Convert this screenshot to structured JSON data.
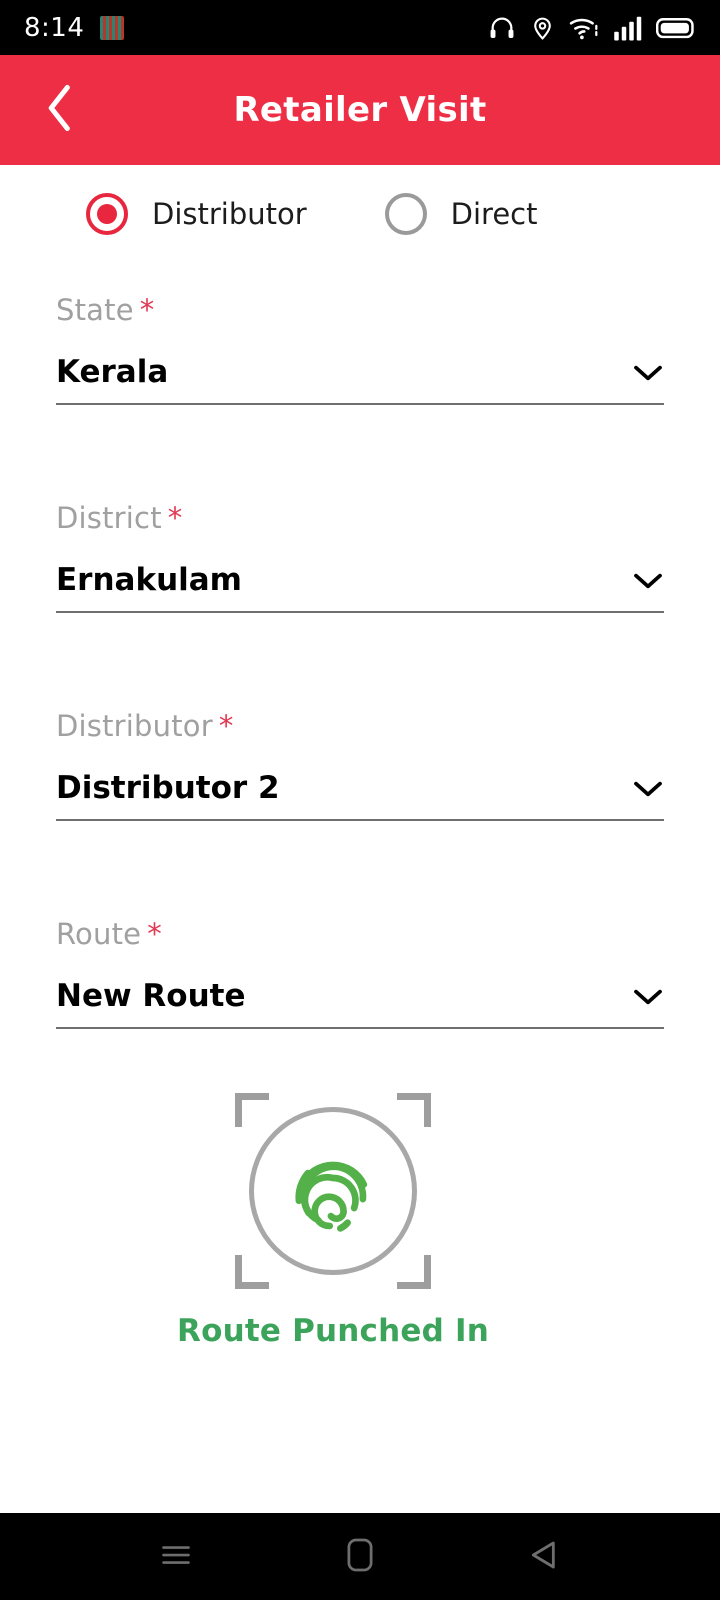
{
  "status_bar": {
    "time": "8:14",
    "app_icon": "app-notification-icon",
    "icons": [
      "headset-icon",
      "location-pin-icon",
      "wifi-icon",
      "signal-bars-icon",
      "battery-icon"
    ]
  },
  "app_bar": {
    "back_icon": "chevron-left-icon",
    "title": "Retailer Visit",
    "background_color": "#ED2E45"
  },
  "visit_type": {
    "options": [
      {
        "label": "Distributor",
        "selected": true
      },
      {
        "label": "Direct",
        "selected": false
      }
    ],
    "selected_color": "#E8273F"
  },
  "form": {
    "required_marker": "*",
    "fields": [
      {
        "label": "State",
        "value": "Kerala",
        "dropdown_icon": "chevron-down-icon"
      },
      {
        "label": "District",
        "value": "Ernakulam",
        "dropdown_icon": "chevron-down-icon"
      },
      {
        "label": "Distributor",
        "value": "Distributor 2",
        "dropdown_icon": "chevron-down-icon"
      },
      {
        "label": "Route",
        "value": "New Route",
        "dropdown_icon": "chevron-down-icon"
      }
    ]
  },
  "fingerprint": {
    "icon": "fingerprint-icon",
    "frame_icon": "scanner-frame-icon",
    "status_text": "Route Punched In",
    "status_color": "#3BA45A",
    "frame_color": "#9e9e9e"
  },
  "nav_bar": {
    "buttons": [
      {
        "name": "recents-button",
        "icon": "menu-lines-icon"
      },
      {
        "name": "home-button",
        "icon": "rounded-square-icon"
      },
      {
        "name": "back-button",
        "icon": "triangle-left-icon"
      }
    ]
  }
}
